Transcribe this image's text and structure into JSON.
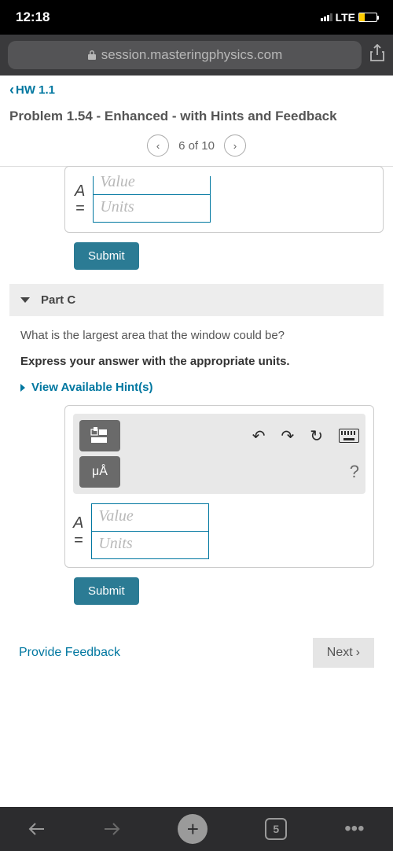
{
  "statusBar": {
    "time": "12:18",
    "network": "LTE"
  },
  "browser": {
    "url": "session.masteringphysics.com"
  },
  "nav": {
    "backLabel": "HW 1.1"
  },
  "header": {
    "title": "Problem 1.54 - Enhanced - with Hints and Feedback",
    "pagerText": "6 of 10"
  },
  "partB": {
    "varLabel": "A",
    "equals": "=",
    "valuePlaceholder": "Value",
    "unitsPlaceholder": "Units",
    "submitLabel": "Submit"
  },
  "partC": {
    "headerLabel": "Part C",
    "question": "What is the largest area that the window could be?",
    "instruction": "Express your answer with the appropriate units.",
    "hintsLabel": "View Available Hint(s)",
    "unitsBtnLabel": "μÅ",
    "helpLabel": "?",
    "varLabel": "A",
    "equals": "=",
    "valuePlaceholder": "Value",
    "unitsPlaceholder": "Units",
    "submitLabel": "Submit"
  },
  "footer": {
    "feedbackLabel": "Provide Feedback",
    "nextLabel": "Next"
  },
  "bottomBar": {
    "tabCount": "5"
  }
}
